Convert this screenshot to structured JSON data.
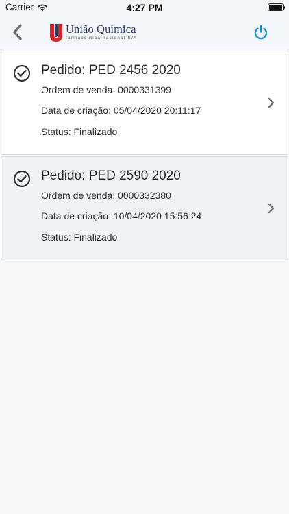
{
  "status_bar": {
    "carrier": "Carrier",
    "time": "4:27 PM"
  },
  "nav": {
    "brand_name": "União Química",
    "brand_sub": "farmacêutica nacional S/A",
    "back_icon": "chevron-left-icon",
    "power_icon": "power-icon",
    "accent": "#1a8fd0",
    "logo_red": "#d0262c"
  },
  "orders": [
    {
      "title": "Pedido: PED 2456 2020",
      "ordem": "Ordem de venda: 0000331399",
      "data": "Data de criação: 05/04/2020 20:11:17",
      "status": "Status: Finalizado"
    },
    {
      "title": "Pedido: PED 2590 2020",
      "ordem": "Ordem de venda: 0000332380",
      "data": "Data de criação: 10/04/2020 15:56:24",
      "status": "Status: Finalizado"
    }
  ]
}
